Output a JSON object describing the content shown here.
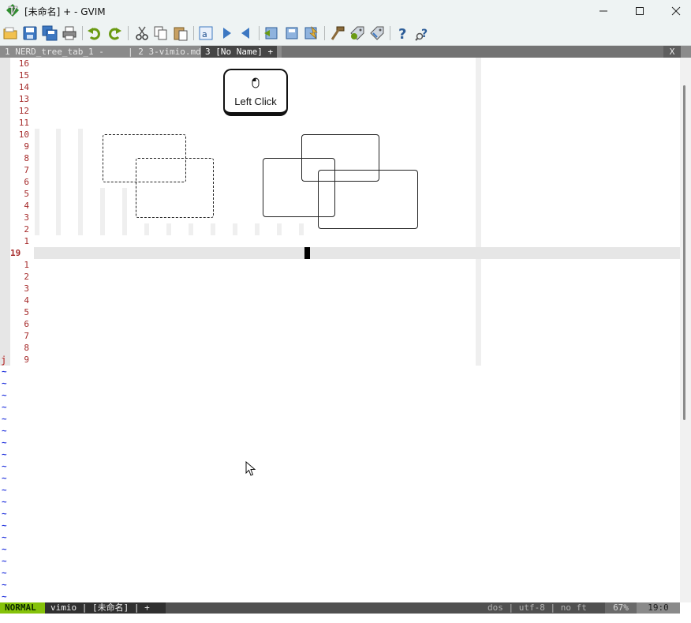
{
  "window": {
    "title": "[未命名] + - GVIM",
    "controls": [
      "minimize",
      "maximize",
      "close"
    ]
  },
  "toolbar": {
    "icons": [
      "open-icon",
      "save-icon",
      "save-all-icon",
      "print-icon",
      "undo-icon",
      "redo-icon",
      "cut-icon",
      "copy-icon",
      "paste-icon",
      "find-replace-icon",
      "find-next-icon",
      "find-prev-icon",
      "load-session-icon",
      "save-session-icon",
      "run-script-icon",
      "make-icon",
      "build-tags-icon",
      "jump-tag-icon",
      "help-icon",
      "find-help-icon"
    ]
  },
  "tabs": {
    "items": [
      {
        "label": "1 NERD_tree_tab_1 - "
      },
      {
        "label": "| 2 3-vimio.md "
      },
      {
        "label": "3 [No Name] +"
      }
    ],
    "close_label": "X"
  },
  "editor": {
    "above_numbers": [
      "16",
      "15",
      "14",
      "13",
      "12",
      "11",
      "10",
      "9",
      "8",
      "7",
      "6",
      "5",
      "4",
      "3",
      "2",
      "1"
    ],
    "current_line": "19",
    "below_numbers": [
      "1",
      "2",
      "3",
      "4",
      "5",
      "6",
      "7",
      "8",
      "9"
    ],
    "tilde": "~",
    "mark": "j"
  },
  "keycap": {
    "label": "Left Click"
  },
  "statusline": {
    "mode": "NORMAL",
    "file": "vimio | [未命名] | +",
    "info": "dos | utf-8 | no ft",
    "percent": "67%",
    "position": "19:0"
  }
}
